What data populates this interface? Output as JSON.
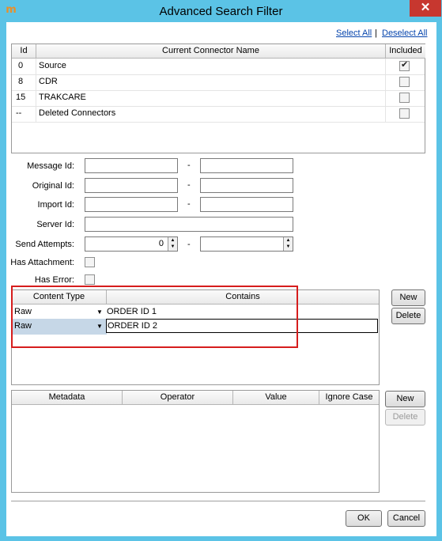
{
  "window": {
    "title": "Advanced Search Filter",
    "close_glyph": "✕"
  },
  "links": {
    "select_all": "Select All",
    "separator": "|",
    "deselect_all": "Deselect All"
  },
  "connector_table": {
    "headers": [
      "Id",
      "Current Connector Name",
      "Included"
    ],
    "rows": [
      {
        "id": "0",
        "name": "Source",
        "included": true
      },
      {
        "id": "8",
        "name": "CDR",
        "included": false
      },
      {
        "id": "15",
        "name": "TRAKCARE",
        "included": false
      },
      {
        "id": "--",
        "name": "Deleted Connectors",
        "included": false
      }
    ]
  },
  "form": {
    "message_id_label": "Message Id:",
    "original_id_label": "Original Id:",
    "import_id_label": "Import Id:",
    "server_id_label": "Server Id:",
    "send_attempts_label": "Send Attempts:",
    "send_attempts_value": "0",
    "has_attachment_label": "Has Attachment:",
    "has_error_label": "Has Error:",
    "dash": "-"
  },
  "content_table": {
    "headers": [
      "Content Type",
      "Contains"
    ],
    "rows": [
      {
        "type": "Raw",
        "contains": "ORDER ID 1"
      },
      {
        "type": "Raw",
        "contains": "ORDER ID 2"
      }
    ],
    "new_label": "New",
    "delete_label": "Delete"
  },
  "metadata_table": {
    "headers": [
      "Metadata",
      "Operator",
      "Value",
      "Ignore Case"
    ],
    "new_label": "New",
    "delete_label": "Delete"
  },
  "footer": {
    "ok_label": "OK",
    "cancel_label": "Cancel"
  },
  "colors": {
    "title_bar": "#5bc3e6",
    "close_button": "#c7372f",
    "highlight_box": "#d61d1d",
    "link": "#0645ad"
  },
  "icons": {
    "app": "mirth-icon",
    "close": "close-icon",
    "checkbox_checked": "checkmark-icon",
    "dropdown": "chevron-down-icon",
    "spin_up": "spin-up-icon",
    "spin_down": "spin-down-icon"
  }
}
